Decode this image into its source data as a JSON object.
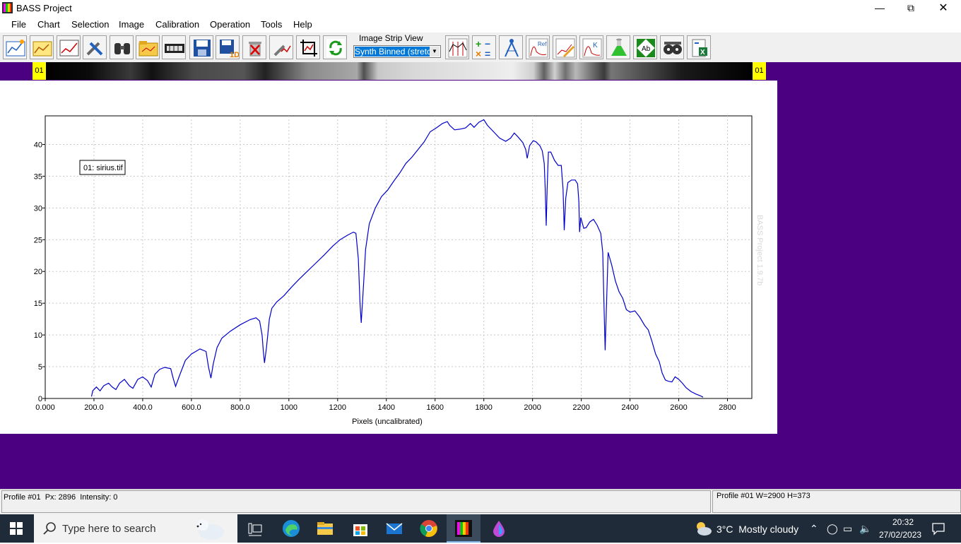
{
  "window": {
    "title": "BASS Project"
  },
  "menu": [
    "File",
    "Chart",
    "Selection",
    "Image",
    "Calibration",
    "Operation",
    "Tools",
    "Help"
  ],
  "toolbar": {
    "strip_label": "Image Strip View",
    "strip_value": "Synth Binned (stretch",
    "icons_left": [
      "open-profile-icon",
      "open-image-icon",
      "chart-icon",
      "tools-icon",
      "binoculars-icon",
      "folder-icon",
      "film-strip-icon",
      "save-icon",
      "save-1d-icon",
      "delete-icon",
      "edit-tools-icon",
      "crop-icon",
      "refresh-icon"
    ],
    "icons_right": [
      "line-spectrum-icon",
      "math-operations-icon",
      "compass-icon",
      "reference-icon",
      "pen-chart-icon",
      "k-icon",
      "flask-icon",
      "ab-icon",
      "film-reel-icon",
      "export-excel-icon"
    ]
  },
  "strip": {
    "left_label": "01",
    "right_label": "01"
  },
  "chart_data": {
    "type": "line",
    "xlabel": "Pixels (uncalibrated)",
    "ylabel": "",
    "x_ticks": [
      "0.000",
      "200.0",
      "400.0",
      "600.0",
      "800.0",
      "1000",
      "1200",
      "1400",
      "1600",
      "1800",
      "2000",
      "2200",
      "2400",
      "2600",
      "2800"
    ],
    "y_ticks": [
      "0",
      "5",
      "10",
      "15",
      "20",
      "25",
      "30",
      "35",
      "40"
    ],
    "xlim": [
      0,
      2900
    ],
    "ylim": [
      0,
      44.5
    ],
    "grid": true,
    "legend": "01: sirius.tif",
    "legend_position": "top-left",
    "watermark": "BASS Project 1.9.7b",
    "series": [
      {
        "name": "01: sirius.tif",
        "color": "#0000cc",
        "points": [
          [
            190,
            0.3
          ],
          [
            195,
            1.2
          ],
          [
            210,
            1.8
          ],
          [
            225,
            1.2
          ],
          [
            240,
            2.0
          ],
          [
            260,
            2.4
          ],
          [
            275,
            1.8
          ],
          [
            290,
            1.4
          ],
          [
            305,
            2.4
          ],
          [
            325,
            3.0
          ],
          [
            345,
            2.0
          ],
          [
            360,
            1.6
          ],
          [
            380,
            3.0
          ],
          [
            400,
            3.4
          ],
          [
            420,
            2.8
          ],
          [
            435,
            1.8
          ],
          [
            450,
            3.8
          ],
          [
            470,
            4.6
          ],
          [
            490,
            4.9
          ],
          [
            515,
            4.7
          ],
          [
            525,
            3.2
          ],
          [
            535,
            1.9
          ],
          [
            550,
            3.5
          ],
          [
            575,
            6.0
          ],
          [
            600,
            7.0
          ],
          [
            635,
            7.8
          ],
          [
            660,
            7.4
          ],
          [
            670,
            5.0
          ],
          [
            680,
            3.2
          ],
          [
            690,
            5.5
          ],
          [
            705,
            8.0
          ],
          [
            725,
            9.5
          ],
          [
            760,
            10.6
          ],
          [
            800,
            11.6
          ],
          [
            840,
            12.4
          ],
          [
            865,
            12.7
          ],
          [
            880,
            12.2
          ],
          [
            890,
            10.0
          ],
          [
            895,
            7.5
          ],
          [
            900,
            5.6
          ],
          [
            908,
            8.0
          ],
          [
            920,
            12.5
          ],
          [
            930,
            14.2
          ],
          [
            950,
            15.2
          ],
          [
            980,
            16.2
          ],
          [
            1010,
            17.5
          ],
          [
            1040,
            18.7
          ],
          [
            1075,
            20.0
          ],
          [
            1110,
            21.3
          ],
          [
            1145,
            22.6
          ],
          [
            1180,
            24.0
          ],
          [
            1210,
            25.0
          ],
          [
            1240,
            25.7
          ],
          [
            1265,
            26.2
          ],
          [
            1275,
            26.0
          ],
          [
            1285,
            22.0
          ],
          [
            1292,
            15.0
          ],
          [
            1297,
            11.9
          ],
          [
            1305,
            17.0
          ],
          [
            1315,
            23.5
          ],
          [
            1330,
            27.5
          ],
          [
            1355,
            30.0
          ],
          [
            1380,
            31.8
          ],
          [
            1405,
            32.8
          ],
          [
            1430,
            34.2
          ],
          [
            1455,
            35.5
          ],
          [
            1480,
            37.0
          ],
          [
            1505,
            38.0
          ],
          [
            1530,
            39.2
          ],
          [
            1555,
            40.4
          ],
          [
            1580,
            42.0
          ],
          [
            1605,
            42.6
          ],
          [
            1630,
            43.3
          ],
          [
            1650,
            43.6
          ],
          [
            1660,
            43.0
          ],
          [
            1680,
            42.3
          ],
          [
            1700,
            42.4
          ],
          [
            1725,
            42.6
          ],
          [
            1745,
            43.3
          ],
          [
            1760,
            42.7
          ],
          [
            1780,
            43.5
          ],
          [
            1800,
            43.9
          ],
          [
            1815,
            43.0
          ],
          [
            1840,
            42.0
          ],
          [
            1865,
            41.0
          ],
          [
            1890,
            40.5
          ],
          [
            1910,
            41.0
          ],
          [
            1925,
            41.8
          ],
          [
            1940,
            41.2
          ],
          [
            1960,
            40.3
          ],
          [
            1972,
            39.2
          ],
          [
            1978,
            37.8
          ],
          [
            1988,
            39.8
          ],
          [
            2003,
            40.6
          ],
          [
            2015,
            40.4
          ],
          [
            2030,
            39.8
          ],
          [
            2040,
            39.0
          ],
          [
            2048,
            37.0
          ],
          [
            2052,
            33.0
          ],
          [
            2056,
            27.2
          ],
          [
            2060,
            33.0
          ],
          [
            2065,
            38.8
          ],
          [
            2075,
            38.8
          ],
          [
            2090,
            37.5
          ],
          [
            2105,
            36.7
          ],
          [
            2118,
            36.7
          ],
          [
            2125,
            33.0
          ],
          [
            2130,
            26.5
          ],
          [
            2136,
            31.5
          ],
          [
            2145,
            34.0
          ],
          [
            2160,
            34.4
          ],
          [
            2175,
            34.4
          ],
          [
            2185,
            33.8
          ],
          [
            2190,
            31.0
          ],
          [
            2193,
            26.2
          ],
          [
            2198,
            28.5
          ],
          [
            2210,
            26.8
          ],
          [
            2220,
            26.9
          ],
          [
            2235,
            27.8
          ],
          [
            2250,
            28.2
          ],
          [
            2265,
            27.3
          ],
          [
            2280,
            26.0
          ],
          [
            2288,
            23.0
          ],
          [
            2293,
            15.0
          ],
          [
            2298,
            7.6
          ],
          [
            2303,
            14.0
          ],
          [
            2310,
            23.0
          ],
          [
            2325,
            21.0
          ],
          [
            2340,
            18.5
          ],
          [
            2355,
            16.8
          ],
          [
            2370,
            15.8
          ],
          [
            2385,
            14.0
          ],
          [
            2400,
            13.6
          ],
          [
            2420,
            13.8
          ],
          [
            2440,
            12.8
          ],
          [
            2460,
            11.5
          ],
          [
            2475,
            10.8
          ],
          [
            2490,
            9.0
          ],
          [
            2505,
            7.0
          ],
          [
            2520,
            5.8
          ],
          [
            2532,
            4.0
          ],
          [
            2545,
            2.9
          ],
          [
            2558,
            2.7
          ],
          [
            2572,
            2.6
          ],
          [
            2585,
            3.4
          ],
          [
            2600,
            3.0
          ],
          [
            2615,
            2.4
          ],
          [
            2630,
            1.7
          ],
          [
            2650,
            1.1
          ],
          [
            2670,
            0.7
          ],
          [
            2690,
            0.4
          ],
          [
            2700,
            0.2
          ]
        ]
      }
    ]
  },
  "status": {
    "left": "Profile #01  Px: 2896  Intensity: 0",
    "right": "Profile #01 W=2900 H=373"
  },
  "taskbar": {
    "search_placeholder": "Type here to search",
    "weather": "3°C  Mostly cloudy",
    "time": "20:32",
    "date": "27/02/2023"
  }
}
